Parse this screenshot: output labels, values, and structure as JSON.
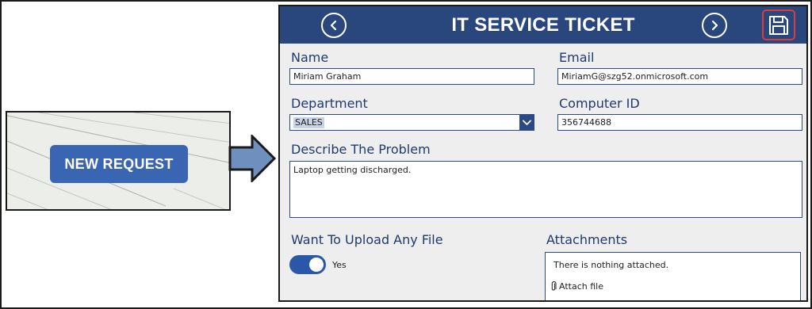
{
  "thumbnail": {
    "button_label": "NEW REQUEST"
  },
  "ticket": {
    "title": "IT SERVICE TICKET",
    "icons": {
      "back": "chevron-left-circle-icon",
      "next": "chevron-right-circle-icon",
      "save": "floppy-disk-icon"
    },
    "fields": {
      "name": {
        "label": "Name",
        "value": "Miriam Graham"
      },
      "email": {
        "label": "Email",
        "value": "MiriamG@szg52.onmicrosoft.com"
      },
      "department": {
        "label": "Department",
        "value": "SALES"
      },
      "computer_id": {
        "label": "Computer ID",
        "value": "356744688"
      },
      "problem": {
        "label": "Describe The Problem",
        "value": "Laptop getting discharged."
      }
    },
    "upload": {
      "label": "Want To Upload Any File",
      "toggle_text": "Yes",
      "toggle_on": true
    },
    "attachments": {
      "label": "Attachments",
      "empty_text": "There is nothing attached.",
      "attach_link": "Attach file"
    }
  },
  "colors": {
    "header": "#29467d",
    "accent": "#3a65b3",
    "label": "#1f3a6e",
    "save_highlight": "#e03a3a"
  }
}
